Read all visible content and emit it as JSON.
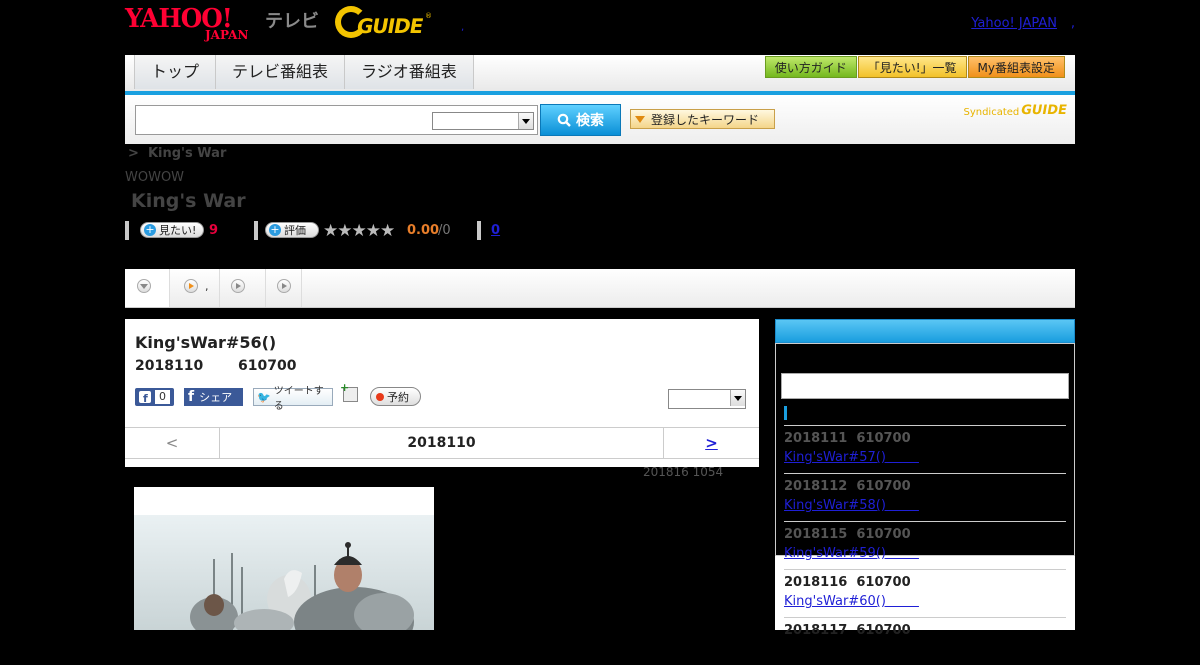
{
  "header": {
    "yahoo_logo": "YAHOO!",
    "yahoo_sub": "JAPAN",
    "service": "テレビ",
    "gguide_logo": "GUIDE",
    "gguide_reg": "®",
    "yahoo_japan_link": "Yahoo! JAPAN",
    "link_sep": ",",
    "tiny_dot": ","
  },
  "nav": {
    "tabs": [
      "トップ",
      "テレビ番組表",
      "ラジオ番組表"
    ],
    "buttons": [
      "使い方ガイド",
      "「見たい!」一覧",
      "My番組表設定"
    ]
  },
  "search": {
    "input_value": "",
    "select_value": "",
    "button_label": "検索",
    "keyword_button": "登録したキーワード",
    "syndicated_text": "Syndicated",
    "syndicated_logo": "GUIDE"
  },
  "program": {
    "breadcrumb_sep": ">",
    "breadcrumb_title": "King's War",
    "channel": "WOWOW",
    "title": "King's War",
    "mitai_label": "見たい!",
    "mitai_count": "9",
    "rate_label": "評価",
    "stars": "★★★★★",
    "rating": "0.00",
    "rating_count": "/0",
    "review_count": "0"
  },
  "subtabs": [
    {
      "label": ""
    },
    {
      "label": ","
    },
    {
      "label": ""
    },
    {
      "label": ""
    }
  ],
  "episode": {
    "title": "King'sWar#56()",
    "date": "2018110",
    "time": "610700",
    "fb_like_count": "0",
    "fb_share_label": "シェア",
    "tweet_label": "ツイートする",
    "reserve_label": "予約",
    "select_value": "",
    "prev": "<",
    "current": "2018110",
    "next": ">",
    "updated": "201816  1054"
  },
  "sidebar": {
    "items": [
      {
        "date": "2018111  610700",
        "title": "King'sWar#57()        "
      },
      {
        "date": "2018112  610700",
        "title": "King'sWar#58()        "
      },
      {
        "date": "2018115  610700",
        "title": "King'sWar#59()        "
      },
      {
        "date": "2018116  610700",
        "title": "King'sWar#60()        "
      },
      {
        "date": "2018117  610700",
        "title": ""
      }
    ]
  },
  "colors": {
    "accent_blue": "#1aa0e0",
    "link": "#1f1fd6",
    "yahoo_red": "#ff0033",
    "gguide_yellow": "#f3c400",
    "mitai_red": "#e8003c",
    "rating_orange": "#e87e2a"
  },
  "icons": {
    "search": "magnifier-icon",
    "keyword_arrow": "triangle-down-icon",
    "facebook": "facebook-icon",
    "twitter": "twitter-bird-icon",
    "calendar": "calendar-add-icon",
    "reserve": "record-dot-icon"
  }
}
